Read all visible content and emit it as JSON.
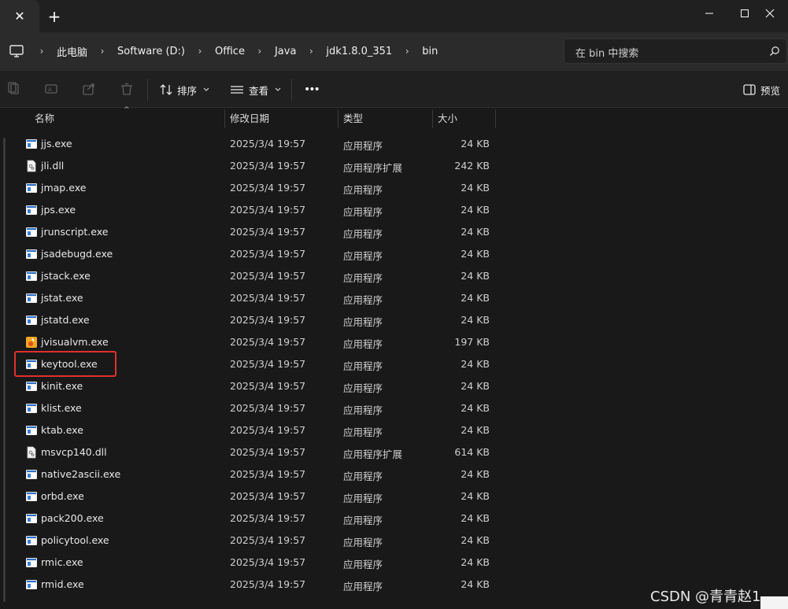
{
  "window": {
    "new_tab_glyph": "+",
    "close_tab_glyph": "✕",
    "minimize_glyph": "—",
    "maximize_glyph": "☐",
    "close_glyph": "✕"
  },
  "breadcrumb": {
    "items": [
      "此电脑",
      "Software (D:)",
      "Office",
      "Java",
      "jdk1.8.0_351",
      "bin"
    ],
    "separator": "›"
  },
  "search": {
    "placeholder": "在 bin 中搜索"
  },
  "toolbar": {
    "sort_label": "排序",
    "view_label": "查看",
    "more_label": "•••",
    "preview_label": "预览"
  },
  "columns": {
    "name": "名称",
    "date": "修改日期",
    "type": "类型",
    "size": "大小"
  },
  "files": [
    {
      "name": "jjs.exe",
      "date": "2025/3/4 19:57",
      "type": "应用程序",
      "size": "24 KB",
      "icon": "exe-icon"
    },
    {
      "name": "jli.dll",
      "date": "2025/3/4 19:57",
      "type": "应用程序扩展",
      "size": "242 KB",
      "icon": "dll-icon"
    },
    {
      "name": "jmap.exe",
      "date": "2025/3/4 19:57",
      "type": "应用程序",
      "size": "24 KB",
      "icon": "exe-icon"
    },
    {
      "name": "jps.exe",
      "date": "2025/3/4 19:57",
      "type": "应用程序",
      "size": "24 KB",
      "icon": "exe-icon"
    },
    {
      "name": "jrunscript.exe",
      "date": "2025/3/4 19:57",
      "type": "应用程序",
      "size": "24 KB",
      "icon": "exe-icon"
    },
    {
      "name": "jsadebugd.exe",
      "date": "2025/3/4 19:57",
      "type": "应用程序",
      "size": "24 KB",
      "icon": "exe-icon"
    },
    {
      "name": "jstack.exe",
      "date": "2025/3/4 19:57",
      "type": "应用程序",
      "size": "24 KB",
      "icon": "exe-icon"
    },
    {
      "name": "jstat.exe",
      "date": "2025/3/4 19:57",
      "type": "应用程序",
      "size": "24 KB",
      "icon": "exe-icon"
    },
    {
      "name": "jstatd.exe",
      "date": "2025/3/4 19:57",
      "type": "应用程序",
      "size": "24 KB",
      "icon": "exe-icon"
    },
    {
      "name": "jvisualvm.exe",
      "date": "2025/3/4 19:57",
      "type": "应用程序",
      "size": "197 KB",
      "icon": "visualvm-icon"
    },
    {
      "name": "keytool.exe",
      "date": "2025/3/4 19:57",
      "type": "应用程序",
      "size": "24 KB",
      "icon": "exe-icon"
    },
    {
      "name": "kinit.exe",
      "date": "2025/3/4 19:57",
      "type": "应用程序",
      "size": "24 KB",
      "icon": "exe-icon"
    },
    {
      "name": "klist.exe",
      "date": "2025/3/4 19:57",
      "type": "应用程序",
      "size": "24 KB",
      "icon": "exe-icon"
    },
    {
      "name": "ktab.exe",
      "date": "2025/3/4 19:57",
      "type": "应用程序",
      "size": "24 KB",
      "icon": "exe-icon"
    },
    {
      "name": "msvcp140.dll",
      "date": "2025/3/4 19:57",
      "type": "应用程序扩展",
      "size": "614 KB",
      "icon": "dll-icon"
    },
    {
      "name": "native2ascii.exe",
      "date": "2025/3/4 19:57",
      "type": "应用程序",
      "size": "24 KB",
      "icon": "exe-icon"
    },
    {
      "name": "orbd.exe",
      "date": "2025/3/4 19:57",
      "type": "应用程序",
      "size": "24 KB",
      "icon": "exe-icon"
    },
    {
      "name": "pack200.exe",
      "date": "2025/3/4 19:57",
      "type": "应用程序",
      "size": "24 KB",
      "icon": "exe-icon"
    },
    {
      "name": "policytool.exe",
      "date": "2025/3/4 19:57",
      "type": "应用程序",
      "size": "24 KB",
      "icon": "exe-icon"
    },
    {
      "name": "rmic.exe",
      "date": "2025/3/4 19:57",
      "type": "应用程序",
      "size": "24 KB",
      "icon": "exe-icon"
    },
    {
      "name": "rmid.exe",
      "date": "2025/3/4 19:57",
      "type": "应用程序",
      "size": "24 KB",
      "icon": "exe-icon"
    }
  ],
  "highlighted_file": "keytool.exe",
  "watermark": "CSDN @青青赵1",
  "colors": {
    "highlight": "#e0302e",
    "background": "#191919",
    "toolbar": "#202020",
    "addressbar": "#2b2b2b"
  }
}
